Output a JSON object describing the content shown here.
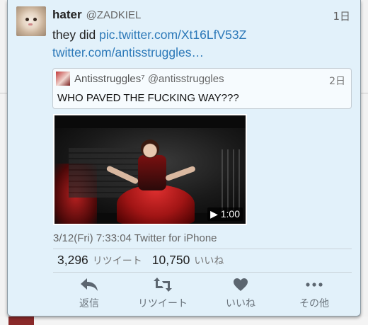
{
  "tweet": {
    "author_name": "hater",
    "author_handle": "@ZADKIEL",
    "time": "1日",
    "text_prefix": "they did ",
    "link1": "pic.twitter.com/Xt16LfV53Z",
    "link2": "twitter.com/antisstruggles…"
  },
  "quote": {
    "name": "Antisstruggles⁷",
    "handle": "@antisstruggles",
    "time": "2日",
    "text": "WHO PAVED THE FUCKING WAY???"
  },
  "media": {
    "duration": "▶ 1:00"
  },
  "meta": {
    "timestamp": "3/12(Fri) 7:33:04 Twitter for iPhone"
  },
  "stats": {
    "retweets": "3,296",
    "retweets_label": "リツイート",
    "likes": "10,750",
    "likes_label": "いいね"
  },
  "actions": {
    "reply_label": "返信",
    "retweet_label": "リツイート",
    "like_label": "いいね",
    "more_label": "その他"
  },
  "colors": {
    "link": "#2b78b8",
    "card_bg": "#e2f1fa"
  }
}
